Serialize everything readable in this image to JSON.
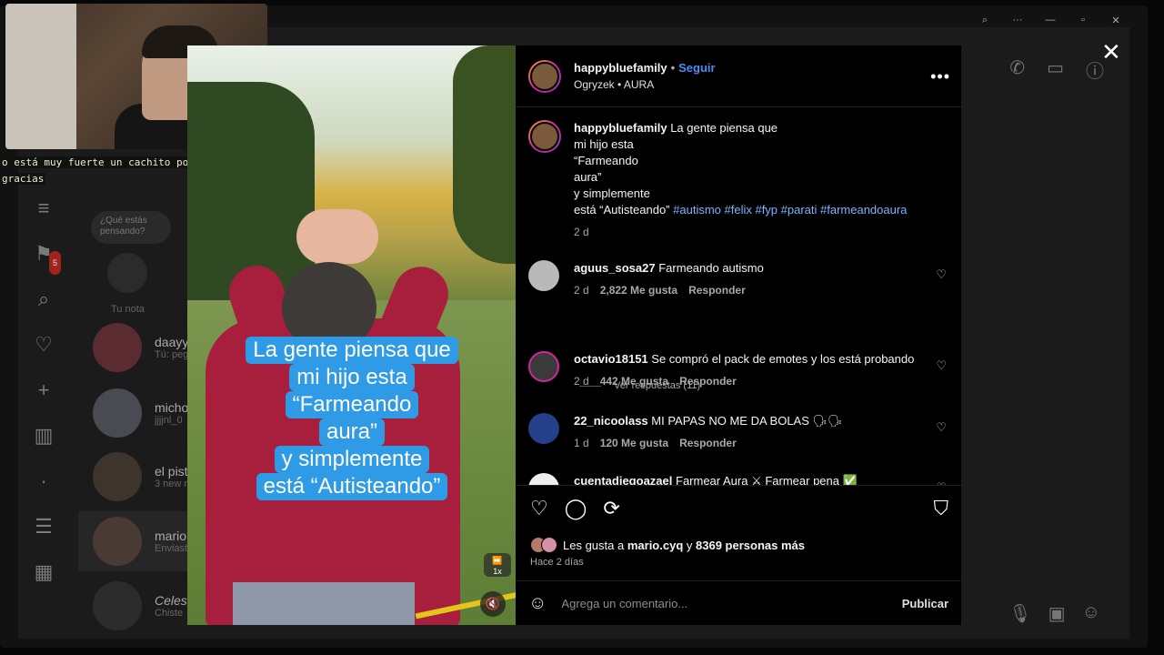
{
  "window_controls": {
    "zoom": "⌕",
    "more": "···",
    "minimize": "—",
    "restore": "▫",
    "close": "✕"
  },
  "webcam_caption": {
    "line1": "o está muy fuerte un cachito por si acaso",
    "line2": "gracias"
  },
  "background_ui": {
    "note_placeholder": "¿Qué estás pensando?",
    "note_label": "Tu nota",
    "badge_count": "5",
    "chats": [
      {
        "name": "daayy",
        "sub": "Tú: peg"
      },
      {
        "name": "micho",
        "sub": "jjjjnl_0"
      },
      {
        "name": "el pist",
        "sub": "3 new m"
      },
      {
        "name": "mario.",
        "sub": "Enviast"
      },
      {
        "name": "Celest",
        "sub": "Chiste"
      }
    ]
  },
  "video": {
    "overlay_lines": [
      "La gente piensa que",
      "mi hijo esta",
      "“Farmeando",
      "aura”",
      "y simplemente",
      "está “Autisteando”"
    ],
    "speed_label": "1x",
    "speed_icon": "fast-forward-icon",
    "mute_icon": "muted-speaker-icon"
  },
  "post": {
    "username": "happybluefamily",
    "follow_label": "Seguir",
    "audio_line": "Ogryzek • AURA",
    "caption_user": "happybluefamily",
    "caption_lines": [
      "La gente piensa que",
      "mi hijo esta",
      "“Farmeando",
      "aura”",
      "y simplemente",
      "está “Autisteando”"
    ],
    "hashtags": "#autismo #felix #fyp #parati #farmeandoaura",
    "caption_time": "2 d"
  },
  "comments": [
    {
      "user": "aguus_sosa27",
      "text": "Farmeando autismo",
      "time": "2 d",
      "likes": "2,822 Me gusta",
      "reply": "Responder"
    },
    {
      "user": "octavio18151",
      "text": "Se compró el pack de emotes y los está probando",
      "time": "2 d",
      "likes": "442 Me gusta",
      "reply": "Responder"
    },
    {
      "user": "22_nicoolass",
      "text": "MI PAPAS NO ME DA BOLAS 🗣🗣",
      "time": "1 d",
      "likes": "120 Me gusta",
      "reply": "Responder"
    },
    {
      "user": "cuentadiegoazael",
      "text": "Farmear Aura ⚔ Farmear pena ✅",
      "time": "",
      "likes": "",
      "reply": ""
    }
  ],
  "view_replies": "Ver respuestas (11)",
  "likes_summary": {
    "prefix": "Les gusta a",
    "user": "mario.cyq",
    "mid": "y",
    "rest": "8369 personas más"
  },
  "posted_ago": "Hace 2 días",
  "comment_input": {
    "placeholder": "Agrega un comentario...",
    "publish": "Publicar"
  }
}
